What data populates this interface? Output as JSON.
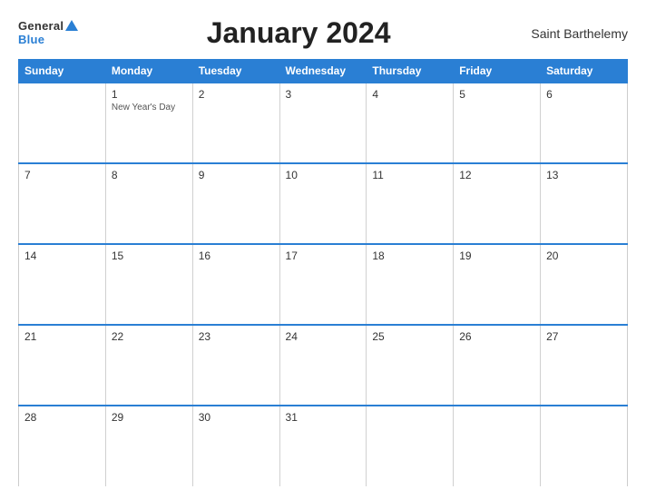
{
  "header": {
    "logo_general": "General",
    "logo_blue": "Blue",
    "title": "January 2024",
    "region": "Saint Barthelemy"
  },
  "weekdays": [
    "Sunday",
    "Monday",
    "Tuesday",
    "Wednesday",
    "Thursday",
    "Friday",
    "Saturday"
  ],
  "weeks": [
    [
      {
        "day": "",
        "holiday": ""
      },
      {
        "day": "1",
        "holiday": "New Year's Day"
      },
      {
        "day": "2",
        "holiday": ""
      },
      {
        "day": "3",
        "holiday": ""
      },
      {
        "day": "4",
        "holiday": ""
      },
      {
        "day": "5",
        "holiday": ""
      },
      {
        "day": "6",
        "holiday": ""
      }
    ],
    [
      {
        "day": "7",
        "holiday": ""
      },
      {
        "day": "8",
        "holiday": ""
      },
      {
        "day": "9",
        "holiday": ""
      },
      {
        "day": "10",
        "holiday": ""
      },
      {
        "day": "11",
        "holiday": ""
      },
      {
        "day": "12",
        "holiday": ""
      },
      {
        "day": "13",
        "holiday": ""
      }
    ],
    [
      {
        "day": "14",
        "holiday": ""
      },
      {
        "day": "15",
        "holiday": ""
      },
      {
        "day": "16",
        "holiday": ""
      },
      {
        "day": "17",
        "holiday": ""
      },
      {
        "day": "18",
        "holiday": ""
      },
      {
        "day": "19",
        "holiday": ""
      },
      {
        "day": "20",
        "holiday": ""
      }
    ],
    [
      {
        "day": "21",
        "holiday": ""
      },
      {
        "day": "22",
        "holiday": ""
      },
      {
        "day": "23",
        "holiday": ""
      },
      {
        "day": "24",
        "holiday": ""
      },
      {
        "day": "25",
        "holiday": ""
      },
      {
        "day": "26",
        "holiday": ""
      },
      {
        "day": "27",
        "holiday": ""
      }
    ],
    [
      {
        "day": "28",
        "holiday": ""
      },
      {
        "day": "29",
        "holiday": ""
      },
      {
        "day": "30",
        "holiday": ""
      },
      {
        "day": "31",
        "holiday": ""
      },
      {
        "day": "",
        "holiday": ""
      },
      {
        "day": "",
        "holiday": ""
      },
      {
        "day": "",
        "holiday": ""
      }
    ]
  ]
}
